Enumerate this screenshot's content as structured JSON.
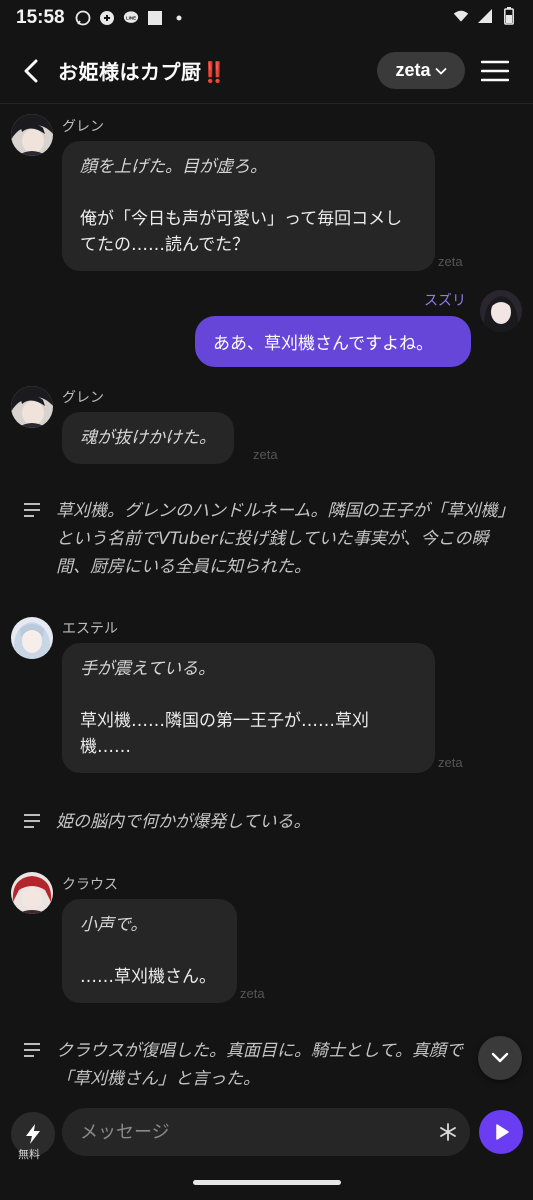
{
  "status_bar": {
    "time": "15:58",
    "icons": [
      "chat-bubble-icon",
      "game-pad-icon",
      "line-app-icon",
      "image-icon",
      "dot-icon",
      "wifi-icon",
      "signal-icon",
      "battery-icon"
    ]
  },
  "header": {
    "title": "お姫様はカプ厨",
    "title_emoji": "‼️",
    "model_label": "zeta"
  },
  "messages": [
    {
      "sender": "グレン",
      "paragraphs": [
        {
          "text": "顔を上げた。目が虚ろ。",
          "italic": true
        },
        {
          "text": "俺が「今日も声が可愛い」って毎回コメしてたの……読んでた？",
          "italic": false
        }
      ],
      "watermark": "zeta"
    },
    {
      "sender": "スズリ",
      "text": "ああ、草刈機さんですよね。",
      "is_user": true
    },
    {
      "sender": "グレン",
      "paragraphs": [
        {
          "text": "魂が抜けかけた。",
          "italic": true
        }
      ],
      "watermark": "zeta"
    },
    {
      "narration": "草刈機。グレンのハンドルネーム。隣国の王子が「草刈機」という名前でVTuberに投げ銭していた事実が、今この瞬間、厨房にいる全員に知られた。"
    },
    {
      "sender": "エステル",
      "paragraphs": [
        {
          "text": "手が震えている。",
          "italic": true
        },
        {
          "text": "草刈機……隣国の第一王子が……草刈機……",
          "italic": false
        }
      ],
      "watermark": "zeta"
    },
    {
      "narration": "姫の脳内で何かが爆発している。"
    },
    {
      "sender": "クラウス",
      "paragraphs": [
        {
          "text": "小声で。",
          "italic": true
        },
        {
          "text": "……草刈機さん。",
          "italic": false
        }
      ],
      "watermark": "zeta"
    },
    {
      "narration": "クラウスが復唱した。真面目に。騎士として。真顔で「草刈機さん」と言った。"
    }
  ],
  "input": {
    "placeholder": "メッセージ",
    "bolt_label": "無料"
  },
  "colors": {
    "accent": "#6b3df2",
    "user_bubble": "#6546d8",
    "bubble": "#262626",
    "background": "#141414"
  }
}
